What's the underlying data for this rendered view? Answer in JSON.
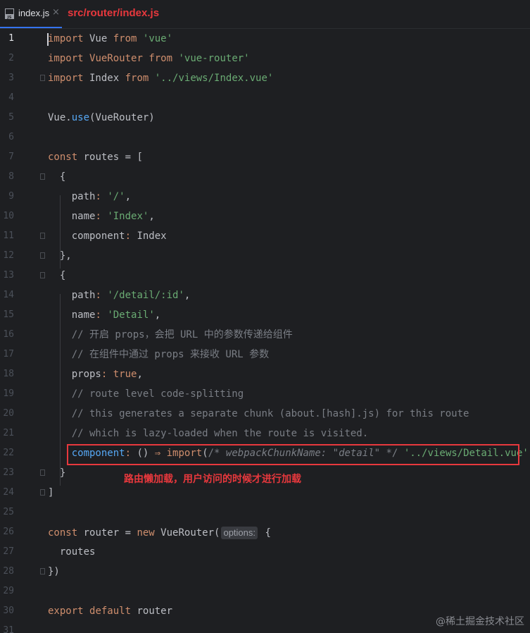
{
  "tab": {
    "icon": "js-file-icon",
    "icon_text": "JS",
    "label": "index.js",
    "close_glyph": "×"
  },
  "annotation": {
    "file_path": "src/router/index.js",
    "lazy_note": "路由懒加载，用户访问的时候才进行加载"
  },
  "editor": {
    "current_line": 1,
    "lines": [
      {
        "n": "1",
        "segs": [
          [
            "kw",
            "import"
          ],
          [
            "op",
            " Vue "
          ],
          [
            "kw",
            "from"
          ],
          [
            "op",
            " "
          ],
          [
            "str",
            "'vue'"
          ]
        ]
      },
      {
        "n": "2",
        "segs": [
          [
            "kw",
            "import"
          ],
          [
            "op",
            " "
          ],
          [
            "kw",
            "VueRouter"
          ],
          [
            "op",
            " "
          ],
          [
            "kw",
            "from"
          ],
          [
            "op",
            " "
          ],
          [
            "str",
            "'vue-router'"
          ]
        ]
      },
      {
        "n": "3",
        "segs": [
          [
            "kw",
            "import"
          ],
          [
            "op",
            " Index "
          ],
          [
            "kw",
            "from"
          ],
          [
            "op",
            " "
          ],
          [
            "str",
            "'../views/Index.vue'"
          ]
        ]
      },
      {
        "n": "4",
        "segs": []
      },
      {
        "n": "5",
        "segs": [
          [
            "op",
            "Vue."
          ],
          [
            "fn",
            "use"
          ],
          [
            "op",
            "(VueRouter)"
          ]
        ]
      },
      {
        "n": "6",
        "segs": []
      },
      {
        "n": "7",
        "segs": [
          [
            "kw",
            "const"
          ],
          [
            "op",
            " routes = ["
          ]
        ]
      },
      {
        "n": "8",
        "segs": [
          [
            "op",
            "  {"
          ]
        ]
      },
      {
        "n": "9",
        "segs": [
          [
            "op",
            "    "
          ],
          [
            "prop",
            "path"
          ],
          [
            "kw",
            ":"
          ],
          [
            "op",
            " "
          ],
          [
            "str",
            "'/'"
          ],
          [
            "op",
            ","
          ]
        ]
      },
      {
        "n": "10",
        "segs": [
          [
            "op",
            "    "
          ],
          [
            "prop",
            "name"
          ],
          [
            "kw",
            ":"
          ],
          [
            "op",
            " "
          ],
          [
            "str",
            "'Index'"
          ],
          [
            "op",
            ","
          ]
        ]
      },
      {
        "n": "11",
        "segs": [
          [
            "op",
            "    "
          ],
          [
            "prop",
            "component"
          ],
          [
            "kw",
            ":"
          ],
          [
            "op",
            " Index"
          ]
        ]
      },
      {
        "n": "12",
        "segs": [
          [
            "op",
            "  },"
          ]
        ]
      },
      {
        "n": "13",
        "segs": [
          [
            "op",
            "  {"
          ]
        ]
      },
      {
        "n": "14",
        "segs": [
          [
            "op",
            "    "
          ],
          [
            "prop",
            "path"
          ],
          [
            "kw",
            ":"
          ],
          [
            "op",
            " "
          ],
          [
            "str",
            "'/detail/:id'"
          ],
          [
            "op",
            ","
          ]
        ]
      },
      {
        "n": "15",
        "segs": [
          [
            "op",
            "    "
          ],
          [
            "prop",
            "name"
          ],
          [
            "kw",
            ":"
          ],
          [
            "op",
            " "
          ],
          [
            "str",
            "'Detail'"
          ],
          [
            "op",
            ","
          ]
        ]
      },
      {
        "n": "16",
        "segs": [
          [
            "op",
            "    "
          ],
          [
            "cm",
            "// 开启 props，会把 URL 中的参数传递给组件"
          ]
        ]
      },
      {
        "n": "17",
        "segs": [
          [
            "op",
            "    "
          ],
          [
            "cm",
            "// 在组件中通过 props 来接收 URL 参数"
          ]
        ]
      },
      {
        "n": "18",
        "segs": [
          [
            "op",
            "    "
          ],
          [
            "prop",
            "props"
          ],
          [
            "kw",
            ":"
          ],
          [
            "op",
            " "
          ],
          [
            "kw",
            "true"
          ],
          [
            "op",
            ","
          ]
        ]
      },
      {
        "n": "19",
        "segs": [
          [
            "op",
            "    "
          ],
          [
            "cm",
            "// route level code-splitting"
          ]
        ]
      },
      {
        "n": "20",
        "segs": [
          [
            "op",
            "    "
          ],
          [
            "cm",
            "// this generates a separate chunk (about.[hash].js) for this route"
          ]
        ]
      },
      {
        "n": "21",
        "segs": [
          [
            "op",
            "    "
          ],
          [
            "cm",
            "// which is lazy-loaded when the route is visited."
          ]
        ]
      },
      {
        "n": "22",
        "segs": [
          [
            "op",
            "    "
          ],
          [
            "fn",
            "component"
          ],
          [
            "kw",
            ":"
          ],
          [
            "op",
            " () "
          ],
          [
            "kw",
            "⇒"
          ],
          [
            "op",
            " "
          ],
          [
            "kw",
            "import"
          ],
          [
            "op",
            "("
          ],
          [
            "cm",
            "/* "
          ],
          [
            "cmi",
            "webpackChunkName: \"detail\""
          ],
          [
            "cm",
            " */"
          ],
          [
            "op",
            " "
          ],
          [
            "str",
            "'../views/Detail.vue'"
          ],
          [
            "op",
            ")"
          ]
        ]
      },
      {
        "n": "23",
        "segs": [
          [
            "op",
            "  }"
          ]
        ]
      },
      {
        "n": "24",
        "segs": [
          [
            "op",
            "]"
          ]
        ]
      },
      {
        "n": "25",
        "segs": []
      },
      {
        "n": "26",
        "segs": [
          [
            "kw",
            "const"
          ],
          [
            "op",
            " router = "
          ],
          [
            "kw",
            "new"
          ],
          [
            "op",
            " VueRouter("
          ],
          [
            "hint",
            "options:"
          ],
          [
            "op",
            " {"
          ]
        ]
      },
      {
        "n": "27",
        "segs": [
          [
            "op",
            "  routes"
          ]
        ]
      },
      {
        "n": "28",
        "segs": [
          [
            "op",
            "})"
          ]
        ]
      },
      {
        "n": "29",
        "segs": []
      },
      {
        "n": "30",
        "segs": [
          [
            "kw",
            "export"
          ],
          [
            "op",
            " "
          ],
          [
            "kw",
            "default"
          ],
          [
            "op",
            " router"
          ]
        ]
      },
      {
        "n": "31",
        "segs": []
      }
    ]
  },
  "watermark": "@稀土掘金技术社区"
}
